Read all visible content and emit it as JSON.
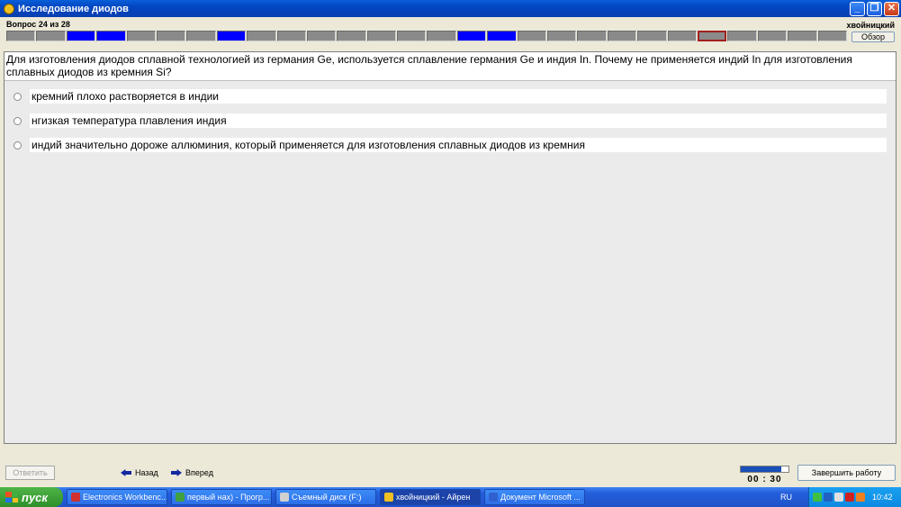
{
  "window": {
    "title": "Исследование диодов"
  },
  "header": {
    "question_counter": "Вопрос 24 из 28",
    "username": "хвойницкий",
    "browse_label": "Обзор",
    "progress": [
      "u",
      "u",
      "a",
      "a",
      "u",
      "u",
      "u",
      "a",
      "u",
      "u",
      "u",
      "u",
      "u",
      "u",
      "u",
      "a",
      "a",
      "u",
      "u",
      "u",
      "u",
      "u",
      "u",
      "c",
      "u",
      "u",
      "u",
      "u"
    ]
  },
  "question": {
    "text": "Для изготовления диодов сплавной технологией из германия Ge, используется сплавление германия Ge и индия In. Почему не применяется индий In для изготовления сплавных диодов из кремния  Si?",
    "options": [
      "кремний плохо растворяется в индии",
      "нгизкая температура плавления индия",
      "индий значительно дороже  аллюминия, который применяется для изготовления сплавных диодов из кремния"
    ]
  },
  "footer": {
    "answer_label": "Ответить",
    "back_label": "Назад",
    "forward_label": "Вперед",
    "timer": "00 : 30",
    "timer_fraction": 0.85,
    "finish_label": "Завершить работу"
  },
  "taskbar": {
    "start_label": "пуск",
    "items": [
      {
        "label": "Electronics Workbenc...",
        "color": "#d03030"
      },
      {
        "label": "первый нах) - Прогр...",
        "color": "#40a040"
      },
      {
        "label": "Съемный диск (F:)",
        "color": "#d0d0d0"
      },
      {
        "label": "хвойницкий - Айрен",
        "color": "#f0c020"
      },
      {
        "label": "Документ Microsoft ...",
        "color": "#3060d0"
      }
    ],
    "active_index": 3,
    "language": "RU",
    "clock": "10:42"
  },
  "colors": {
    "answered": "#0000ff",
    "unanswered": "#8a8a8a",
    "current_border": "#a02020",
    "titlebar": "#0246c2"
  }
}
